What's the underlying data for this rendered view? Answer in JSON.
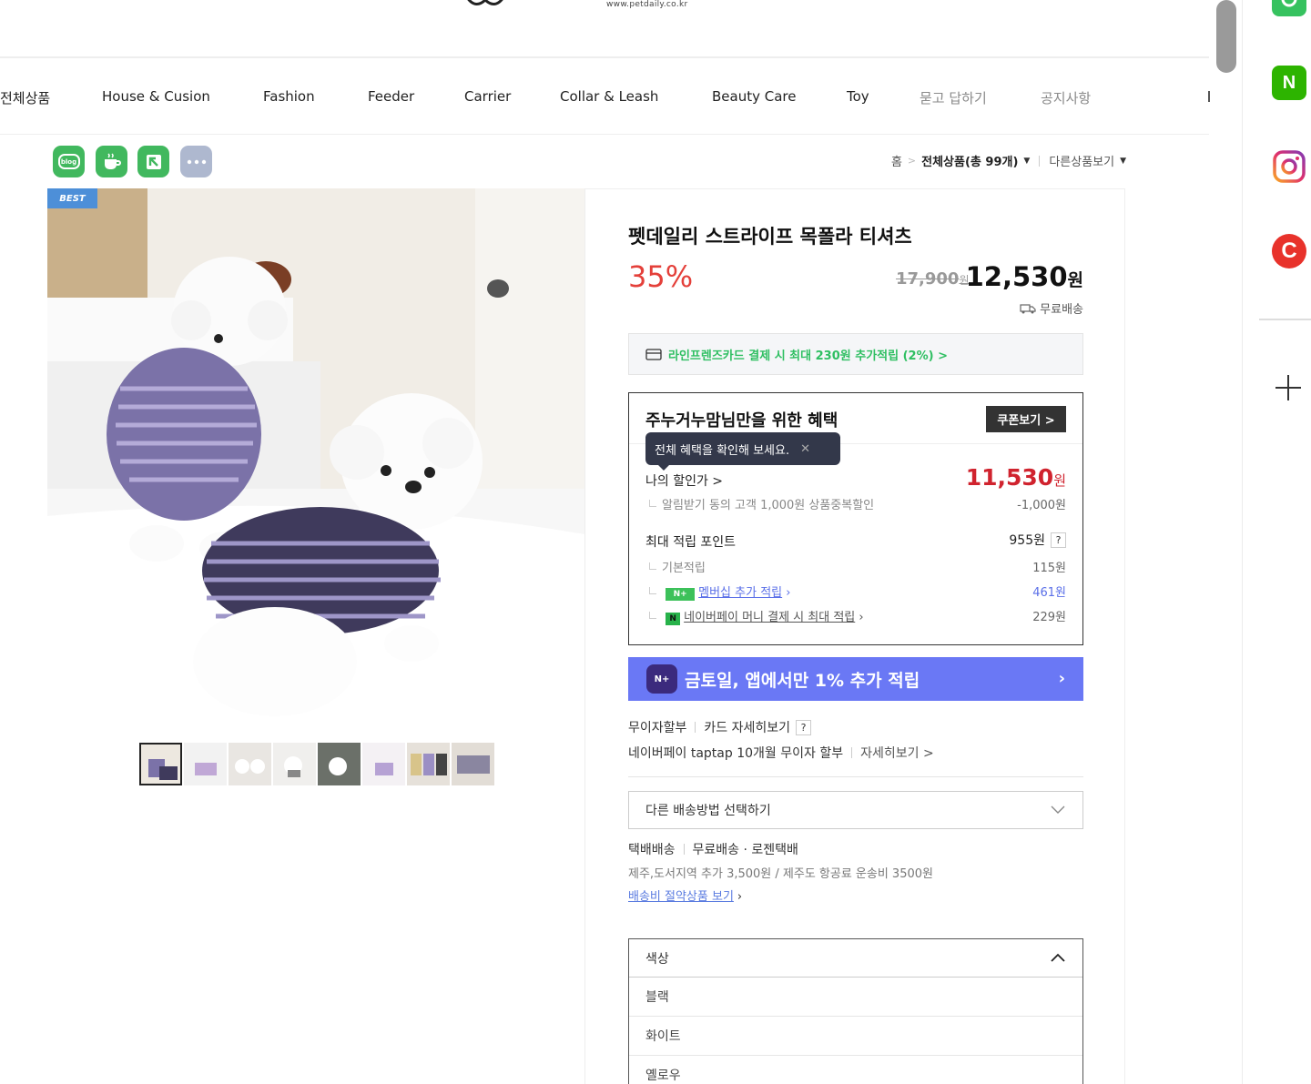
{
  "header": {
    "site_url": "www.petdaily.co.kr"
  },
  "nav": {
    "items": [
      {
        "label": "전체상품"
      },
      {
        "label": "House & Cusion"
      },
      {
        "label": "Fashion"
      },
      {
        "label": "Feeder"
      },
      {
        "label": "Carrier"
      },
      {
        "label": "Collar & Leash"
      },
      {
        "label": "Beauty Care"
      },
      {
        "label": "Toy"
      },
      {
        "label": "묻고 답하기"
      },
      {
        "label": "공지사항"
      }
    ]
  },
  "share": {
    "blog_label": "blog",
    "icons": [
      "blog-icon",
      "talk-icon",
      "bookmark-icon",
      "more-icon"
    ]
  },
  "breadcrumb": {
    "home": "홈",
    "category": "전체상품(총 99개)",
    "other": "다른상품보기"
  },
  "product": {
    "badge": "BEST",
    "title": "펫데일리 스트라이프 목폴라 티셔츠",
    "discount": "35%",
    "original_price": "17,900",
    "original_unit": "원",
    "sale_price": "12,530",
    "sale_unit": "원",
    "shipping": "무료배송",
    "thumbnail_count": 8
  },
  "card_banner": {
    "text": "라인프렌즈카드 결제 시 최대 230원 추가적립 (2%) >"
  },
  "benefits": {
    "title": "주누거누맘님만을 위한 혜택",
    "coupon_button": "쿠폰보기 >",
    "tooltip": "전체 혜택을 확인해 보세요.",
    "my_price_label": "나의 할인가 >",
    "my_price": "11,530",
    "my_price_unit": "원",
    "discount_note": "알림받기 동의 고객 1,000원 상품중복할인",
    "discount_amount": "-1,000원",
    "points_label": "최대 적립 포인트",
    "points_total": "955원",
    "base_label": "기본적립",
    "base_value": "115원",
    "membership_badge": "N+",
    "membership_label": "멤버십 추가 적립",
    "membership_value": "461원",
    "npay_badge": "N",
    "npay_label": "네이버페이 머니 결제 시 최대 적립",
    "npay_value": "229원"
  },
  "app_banner": {
    "text": "금토일, 앱에서만 1% 추가 적립",
    "icon_text": "N+"
  },
  "installment": {
    "label": "무이자할부",
    "card_link": "카드 자세히보기",
    "taptap": "네이버페이 taptap 10개월 무이자 할부",
    "details": "자세히보기 >"
  },
  "delivery": {
    "select_label": "다른 배송방법 선택하기",
    "type": "택배배송",
    "fee": "무료배송 · 로젠택배",
    "note": "제주,도서지역 추가 3,500원 / 제주도 항공료 운송비 3500원",
    "link": "배송비 절약상품 보기"
  },
  "options": {
    "label": "색상",
    "items": [
      "블랙",
      "화이트",
      "옐로우"
    ]
  },
  "sidebar": {
    "icons": [
      "green-app-icon",
      "naver-icon",
      "instagram-icon",
      "c-app-icon"
    ],
    "naver_letter": "N",
    "c_letter": "C"
  },
  "colors": {
    "accent_red": "#e4403a",
    "price_red": "#d0232e",
    "card_green": "#2fbf62",
    "banner_blue": "#6a78f5",
    "best_blue": "#4d8fd8"
  }
}
